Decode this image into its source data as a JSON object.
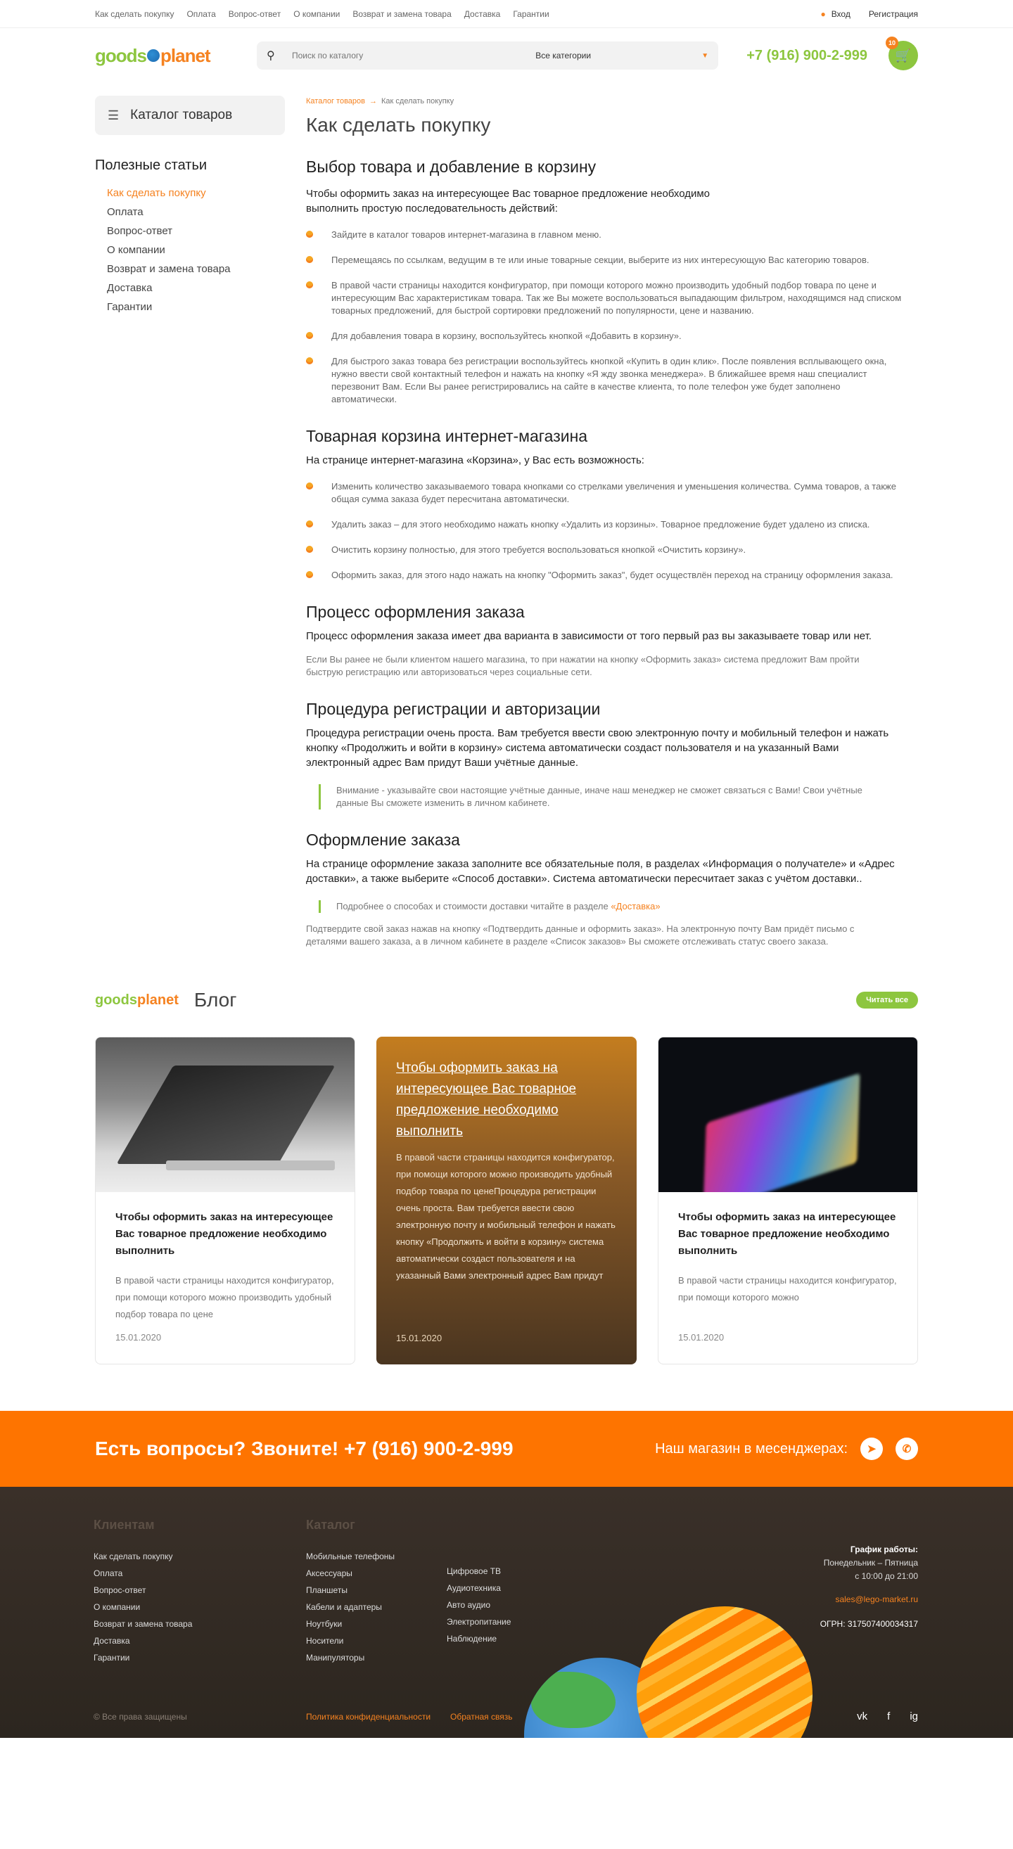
{
  "topbar": {
    "links": [
      "Как сделать покупку",
      "Оплата",
      "Вопрос-ответ",
      "О компании",
      "Возврат и замена товара",
      "Доставка",
      "Гарантии"
    ],
    "login": "Вход",
    "register": "Регистрация"
  },
  "header": {
    "logo_left": "goods",
    "logo_right": "planet",
    "search_placeholder": "Поиск по каталогу",
    "category": "Все категории",
    "phone": "+7 (916) 900-2-999",
    "cart_count": "10"
  },
  "sidebar": {
    "catalog_button": "Каталог товаров",
    "articles_title": "Полезные статьи",
    "items": [
      "Как сделать покупку",
      "Оплата",
      "Вопрос-ответ",
      "О компании",
      "Возврат и замена товара",
      "Доставка",
      "Гарантии"
    ]
  },
  "breadcrumbs": {
    "root": "Каталог товаров",
    "current": "Как сделать покупку"
  },
  "page_title": "Как сделать покупку",
  "sections": {
    "s1": {
      "title": "Выбор товара и добавление в корзину",
      "lead": "Чтобы оформить заказ на интересующее Вас товарное предложение необходимо выполнить простую последовательность действий:",
      "items": [
        "Зайдите в каталог товаров интернет-магазина в главном меню.",
        "Перемещаясь по ссылкам, ведущим в те или иные товарные секции, выберите из них интересующую Вас категорию товаров.",
        "В правой части страницы находится конфигуратор, при помощи которого можно производить удобный подбор товара по цене и интересующим Вас характеристикам товара. Так же Вы можете воспользоваться выпадающим фильтром, находящимся над списком товарных предложений, для быстрой сортировки предложений по популярности, цене и названию.",
        "Для добавления товара в корзину, воспользуйтесь кнопкой «Добавить в корзину».",
        "Для быстрого заказ товара без регистрации воспользуйтесь кнопкой «Купить в один клик». После появления всплывающего окна, нужно ввести свой контактный телефон и нажать на кнопку «Я жду звонка менеджера». В ближайшее время наш специалист перезвонит Вам. Если Вы ранее регистрировались на сайте в качестве клиента, то поле телефон уже будет заполнено автоматически."
      ]
    },
    "s2": {
      "title": "Товарная корзина интернет-магазина",
      "lead": "На странице интернет-магазина «Корзина», у Вас есть возможность:",
      "items": [
        "Изменить количество заказываемого товара кнопками со стрелками увеличения и уменьшения количества. Сумма товаров, а также общая сумма заказа будет пересчитана автоматически.",
        "Удалить заказ – для этого необходимо нажать кнопку «Удалить из корзины». Товарное предложение будет удалено из списка.",
        "Очистить корзину полностью, для этого требуется воспользоваться кнопкой «Очистить корзину».",
        "Оформить заказ, для этого надо нажать на кнопку \"Оформить заказ\", будет осуществлён переход на страницу оформления заказа."
      ]
    },
    "s3": {
      "title": "Процесс оформления заказа",
      "lead": "Процесс оформления заказа имеет два варианта в зависимости от того первый раз вы заказываете товар или нет.",
      "text": "Если Вы ранее не были клиентом нашего магазина, то при нажатии на кнопку «Оформить заказ» система предложит Вам пройти быструю регистрацию или авторизоваться через социальные сети."
    },
    "s4": {
      "title": "Процедура регистрации и авторизации",
      "lead": "Процедура регистрации очень проста. Вам требуется ввести свою электронную почту и мобильный телефон и нажать кнопку «Продолжить и войти в корзину» система автоматически создаст пользователя и на указанный Вами электронный адрес Вам придут Ваши учётные данные.",
      "note": "Внимание - указывайте свои настоящие учётные данные, иначе наш менеджер не сможет связаться с Вами! Свои учётные данные Вы сможете изменить в личном кабинете."
    },
    "s5": {
      "title": "Оформление заказа",
      "lead": "На странице оформление заказа заполните все обязательные поля, в разделах «Информация о получателе» и «Адрес доставки», а также выберите «Способ доставки». Система автоматически пересчитает заказ с учётом доставки..",
      "note_text": "Подробнее о способах и стоимости доставки читайте в разделе ",
      "note_link": "«Доставка»",
      "text": "Подтвердите свой заказ нажав на кнопку «Подтвердить данные и оформить заказ». На электронную почту Вам придёт письмо с деталями вашего заказа, а в личном кабинете в разделе «Список заказов» Вы сможете отслеживать статус своего заказа."
    }
  },
  "blog": {
    "logo_left": "goods",
    "logo_right": "planet",
    "title": "Блог",
    "read_all": "Читать все",
    "cards": [
      {
        "title": "Чтобы оформить заказ на интересующее Вас товарное предложение необходимо выполнить",
        "text": "В правой части страницы находится конфигуратор, при помощи которого можно производить удобный подбор товара по цене",
        "date": "15.01.2020"
      },
      {
        "title": "Чтобы оформить заказ на интересующее Вас товарное предложение необходимо выполнить",
        "text": "В правой части страницы находится конфигуратор, при помощи которого можно производить удобный подбор товара по ценеПроцедура регистрации очень проста. Вам требуется ввести свою электронную почту и мобильный телефон и нажать кнопку «Продолжить и войти в корзину» система автоматически создаст пользователя и на указанный Вами электронный адрес Вам придут",
        "date": "15.01.2020"
      },
      {
        "title": "Чтобы оформить заказ на интересующее Вас товарное предложение необходимо выполнить",
        "text": "В правой части страницы находится конфигуратор, при помощи которого можно",
        "date": "15.01.2020"
      }
    ]
  },
  "callbar": {
    "question": "Есть вопросы? Звоните! +7 (916) 900-2-999",
    "messengers": "Наш магазин в месенджерах:"
  },
  "footer": {
    "clients_title": "Клиентам",
    "clients": [
      "Как сделать покупку",
      "Оплата",
      "Вопрос-ответ",
      "О компании",
      "Возврат и замена товара",
      "Доставка",
      "Гарантии"
    ],
    "catalog_title": "Каталог",
    "catalog1": [
      "Мобильные телефоны",
      "Аксессуары",
      "Планшеты",
      "Кабели и адаптеры",
      "Ноутбуки",
      "Носители",
      "Манипуляторы"
    ],
    "catalog2": [
      "Цифровое ТВ",
      "Аудиотехника",
      "Авто аудио",
      "Электропитание",
      "Наблюдение"
    ],
    "schedule_title": "График работы:",
    "schedule_days": "Понедельник – Пятница",
    "schedule_hours": "с 10:00 до 21:00",
    "email": "sales@lego-market.ru",
    "ogrn": "ОГРН: 317507400034317",
    "copyright": "© Все права защищены",
    "privacy": "Политика конфиденциальности",
    "feedback": "Обратная связь",
    "social": [
      "vk",
      "f",
      "ig"
    ]
  }
}
